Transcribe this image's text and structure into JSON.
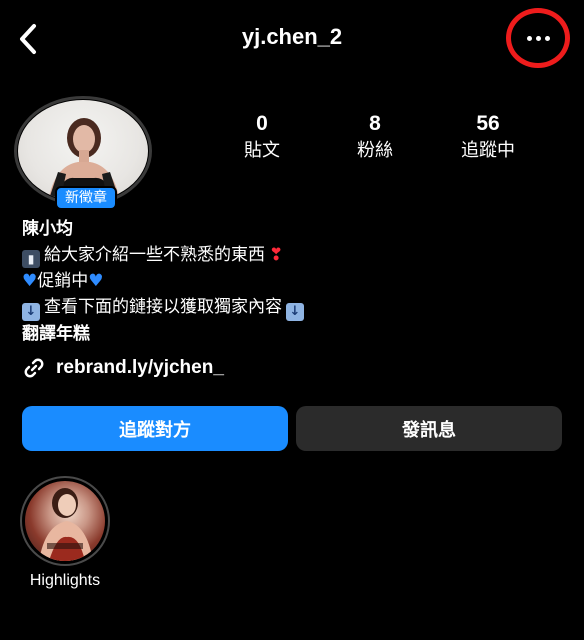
{
  "header": {
    "username": "yj.chen_2",
    "back_icon": "chevron-left-icon",
    "more_icon": "more-horizontal-icon"
  },
  "profile": {
    "badge": "新徵章",
    "stats": [
      {
        "num": "0",
        "label": "貼文"
      },
      {
        "num": "8",
        "label": "粉絲"
      },
      {
        "num": "56",
        "label": "追蹤中"
      }
    ]
  },
  "bio": {
    "name": "陳小均",
    "line1": "給大家介紹一些不熟悉的東西",
    "line2": "促銷中",
    "line3": "查看下面的鏈接以獲取獨家內容",
    "line4": "翻譯年糕"
  },
  "link": {
    "text": "rebrand.ly/yjchen_",
    "icon": "link-icon"
  },
  "buttons": {
    "follow": "追蹤對方",
    "message": "發訊息"
  },
  "highlights": [
    {
      "label": "Highlights"
    }
  ],
  "colors": {
    "background": "#000000",
    "accent": "#1a8cff",
    "secondary_button": "#2b2b2b",
    "annotation_circle": "#ee1c1c"
  }
}
